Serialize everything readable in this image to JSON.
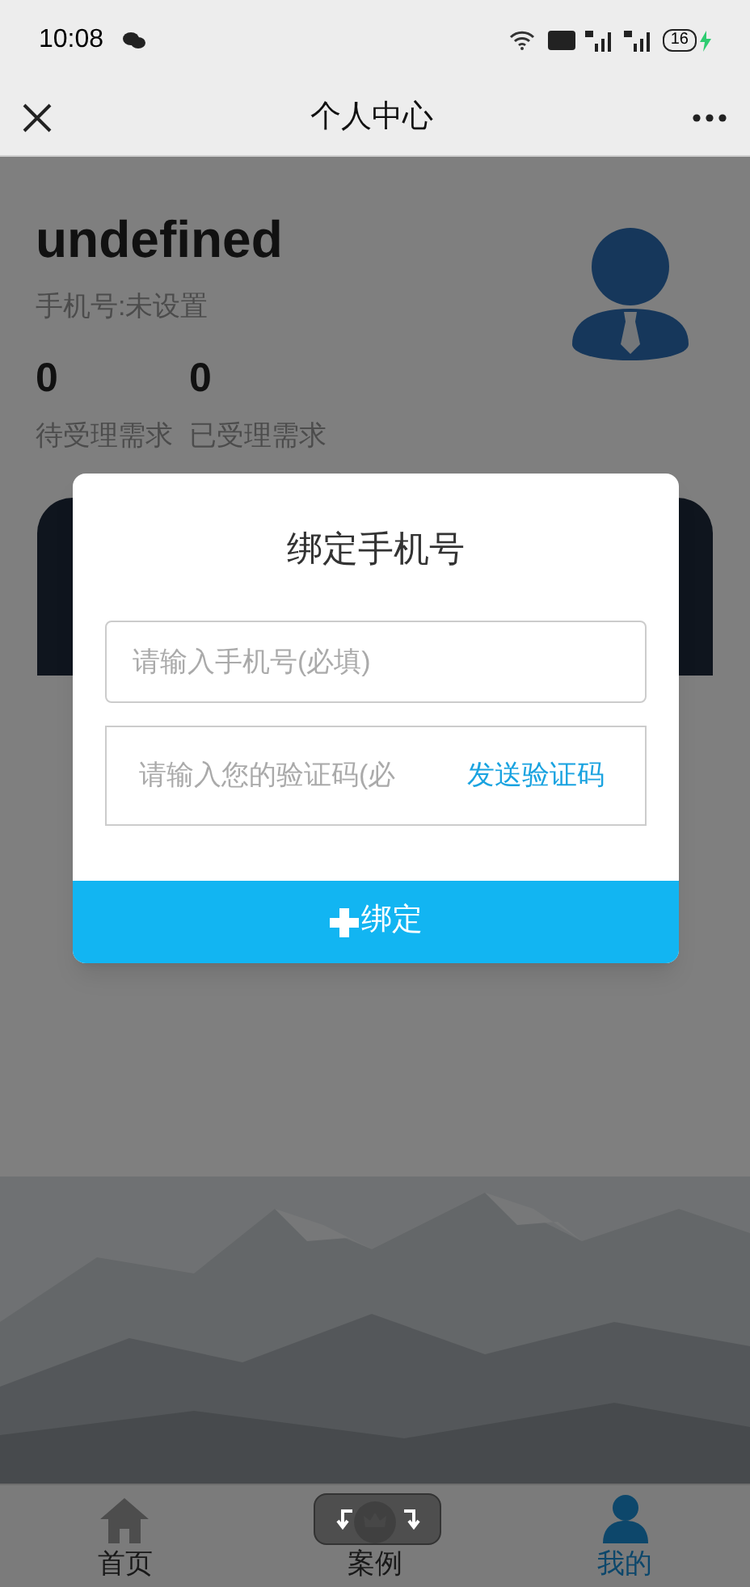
{
  "status_bar": {
    "time": "10:08",
    "battery": "16"
  },
  "nav": {
    "title": "个人中心"
  },
  "profile": {
    "name": "undefined",
    "phone": "手机号:未设置",
    "stats": [
      {
        "value": "0",
        "label": "待受理需求"
      },
      {
        "value": "0",
        "label": "已受理需求"
      }
    ]
  },
  "tab_bar": [
    {
      "label": "首页",
      "kind": "home",
      "selected": false
    },
    {
      "label": "案例",
      "kind": "case",
      "selected": false
    },
    {
      "label": "我的",
      "kind": "me",
      "selected": true
    }
  ],
  "dialog": {
    "title": "绑定手机号",
    "fields": [
      {
        "kind": "input",
        "placeholder": "请输入手机号(必填)"
      },
      {
        "kind": "code",
        "placeholder": "请输入您的验证码(必",
        "action": "发送验证码"
      }
    ],
    "button": "绑定"
  }
}
